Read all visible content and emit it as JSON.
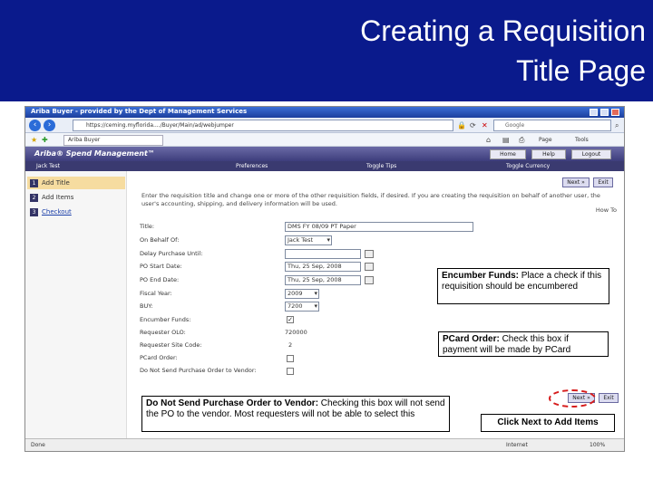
{
  "slide": {
    "title_line1": "Creating a Requisition",
    "title_line2": "Title Page"
  },
  "browser": {
    "window_title": "Ariba Buyer - provided by the Dept of Management Services",
    "url": "https://ceming.myflorida..../Buyer/Main/ad/webjumper",
    "search_placeholder": "Google",
    "tab_label": "Ariba Buyer",
    "toolbar": {
      "page": "Page",
      "tools": "Tools"
    },
    "status_left": "Done",
    "status_right": "Internet",
    "zoom": "100%"
  },
  "ariba": {
    "logo": "Ariba® Spend Management™",
    "top_buttons": {
      "home": "Home",
      "help": "Help",
      "logout": "Logout"
    },
    "user": "Jack Test",
    "menu": {
      "preferences": "Preferences",
      "toggle_tips": "Toggle Tips",
      "toggle_currency": "Toggle Currency"
    }
  },
  "steps": [
    {
      "num": "1",
      "label": "Add Title"
    },
    {
      "num": "2",
      "label": "Add Items"
    },
    {
      "num": "3",
      "label": "Checkout"
    }
  ],
  "content": {
    "next_label": "Next »",
    "exit_label": "Exit",
    "instructions": "Enter the requisition title and change one or more of the other requisition fields, if desired. If you are creating the requisition on behalf of another user, the user's accounting, shipping, and delivery information will be used.",
    "how_to": "How To",
    "fields": [
      {
        "label": "Title:",
        "value": "DMS FY 08/09 PT Paper"
      },
      {
        "label": "On Behalf Of:",
        "value": "Jack Test"
      },
      {
        "label": "Delay Purchase Until:",
        "value": ""
      },
      {
        "label": "PO Start Date:",
        "value": "Thu, 25 Sep, 2008"
      },
      {
        "label": "PO End Date:",
        "value": "Thu, 25 Sep, 2008"
      },
      {
        "label": "Fiscal Year:",
        "value": "2009"
      },
      {
        "label": "BUY:",
        "value": "7200"
      },
      {
        "label": "Encumber Funds:",
        "value": "✓"
      },
      {
        "label": "Requester OLO:",
        "value": "720000"
      },
      {
        "label": "Requester Site Code:",
        "value": "2"
      },
      {
        "label": "PCard Order:",
        "value": ""
      },
      {
        "label": "Do Not Send Purchase Order to Vendor:",
        "value": ""
      }
    ]
  },
  "callouts": {
    "encumber_title": "Encumber Funds:",
    "encumber_text": " Place a check if this requisition should be encumbered",
    "pcard_title": "PCard Order:",
    "pcard_text": "  Check this box if payment will be made by PCard",
    "donotsend_title": "Do Not Send Purchase Order to Vendor:",
    "donotsend_text": "  Checking this box will not send the PO to the vendor. Most requesters will not be able to select this",
    "next_text": "Click Next to Add Items"
  },
  "colors": {
    "title_band": "#0a1a8c",
    "ariba_banner": "#3d3d7c",
    "highlight_circle": "#d61c1c"
  }
}
